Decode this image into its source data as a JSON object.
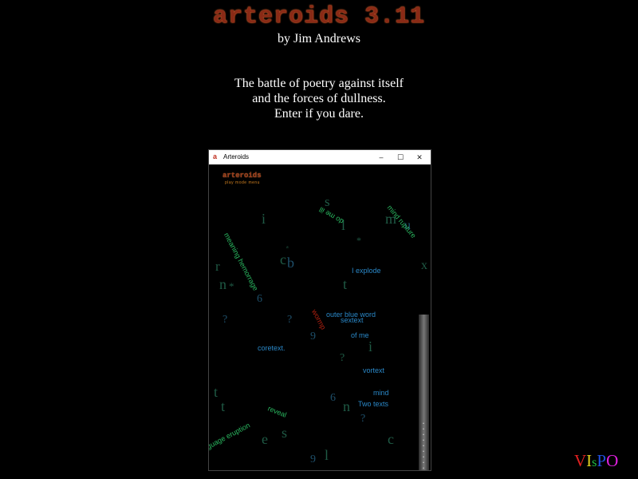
{
  "header": {
    "logo_text": "arteroids 3.11",
    "byline": "by Jim Andrews",
    "intro_lines": [
      "The battle of poetry against itself",
      "and the forces of dullness.",
      "Enter if you dare."
    ]
  },
  "window": {
    "title": "Arteroids",
    "icon": "arteroids-app-icon",
    "controls": {
      "minimize": "–",
      "maximize": "☐",
      "close": "✕"
    }
  },
  "game": {
    "logo": "arteroids",
    "menu": "play mode menu",
    "words": {
      "w1": "do me ill",
      "w2": "mind rupture",
      "w3": "meaning hemorrage",
      "w4": "I explode",
      "w5": "outer blue word",
      "w6": "sextext",
      "w7": "of me",
      "w8": "coretext.",
      "w9": "vortext",
      "w10": "mind",
      "w11": "Two texts",
      "w12": "reveal",
      "w13": "guage eruption",
      "w14": "wormp"
    },
    "letters": {
      "l1": "i",
      "l2": "s",
      "l3": "l",
      "l4": "m",
      "l5": "u",
      "l6": "*",
      "l7": "r",
      "l8": "c",
      "l9": "b",
      "l10": "x",
      "l11": "n",
      "l12": "*",
      "l13": "t",
      "l14": "6",
      "l15": "?",
      "l16": "?",
      "l17": "9",
      "l18": "?",
      "l19": "i",
      "l20": "t",
      "l21": "t",
      "l22": "6",
      "l23": "n",
      "l24": "?",
      "l25": "e",
      "l26": "s",
      "l27": "c",
      "l28": "9",
      "l29": "l",
      "l30": "a"
    },
    "scroll_dots": "•\n•\n•\n•\n•\n•\n•\n•\n•\n•"
  },
  "footer": {
    "vispo": [
      "V",
      "I",
      "s",
      "P",
      "O"
    ],
    "vispo_colors": [
      "#e02020",
      "#e0d020",
      "#20c040",
      "#2050e0",
      "#e020e0"
    ]
  }
}
